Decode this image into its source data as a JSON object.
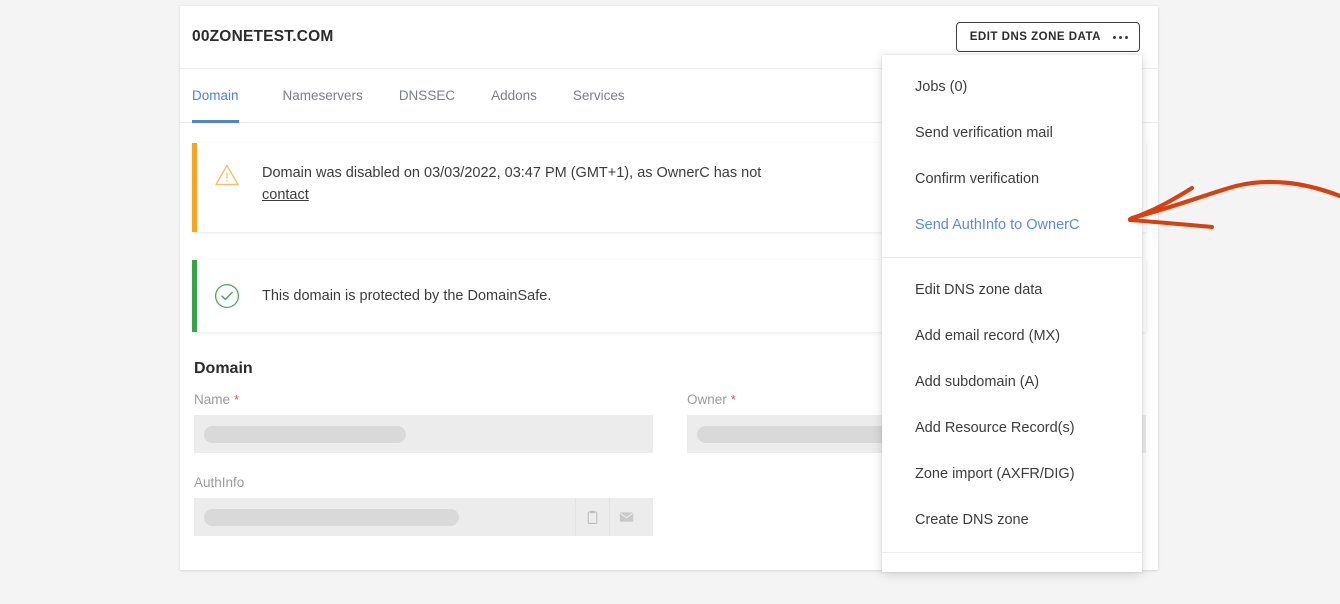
{
  "header": {
    "title": "00ZONETEST.COM",
    "edit_zone_button": "EDIT DNS ZONE DATA",
    "kebab_icon": "more-horizontal-icon"
  },
  "tabs": [
    {
      "label": "Domain",
      "active": true
    },
    {
      "label": "Nameservers",
      "active": false
    },
    {
      "label": "DNSSEC",
      "active": false
    },
    {
      "label": "Addons",
      "active": false
    },
    {
      "label": "Services",
      "active": false
    }
  ],
  "alerts": [
    {
      "type": "warning",
      "icon": "warning-triangle-icon",
      "text": "Domain was disabled on 03/03/2022, 03:47 PM (GMT+1), as OwnerC has not",
      "link": "contact",
      "bar_color": "#f5a623"
    },
    {
      "type": "success",
      "icon": "check-circle-icon",
      "text": "This domain is protected by the DomainSafe.",
      "bar_color": "#37a24a"
    }
  ],
  "form": {
    "section_title": "Domain",
    "fields": [
      {
        "label": "Name",
        "required": true,
        "value": "",
        "skeleton_width": "46%"
      },
      {
        "label": "Owner",
        "required": true,
        "value": "",
        "skeleton_width": "78%"
      },
      {
        "label": "AuthInfo",
        "required": false,
        "value": "",
        "skeleton_width": "58%",
        "actions": [
          "clipboard-icon",
          "mail-icon"
        ]
      }
    ],
    "required_marker": "*"
  },
  "dropdown": {
    "groups": [
      {
        "items": [
          {
            "label": "Jobs (0)",
            "highlight": false
          },
          {
            "label": "Send verification mail",
            "highlight": false
          },
          {
            "label": "Confirm verification",
            "highlight": false
          },
          {
            "label": "Send AuthInfo to OwnerC",
            "highlight": true
          }
        ]
      },
      {
        "items": [
          {
            "label": "Edit DNS zone data",
            "highlight": false
          },
          {
            "label": "Add email record (MX)",
            "highlight": false
          },
          {
            "label": "Add subdomain (A)",
            "highlight": false
          },
          {
            "label": "Add Resource Record(s)",
            "highlight": false
          },
          {
            "label": "Zone import (AXFR/DIG)",
            "highlight": false
          },
          {
            "label": "Create DNS zone",
            "highlight": false
          }
        ]
      }
    ]
  },
  "annotation": {
    "type": "arrow",
    "color": "#d9400f",
    "points_to": "Send AuthInfo to OwnerC"
  },
  "colors": {
    "accent_blue": "#4f83d8",
    "page_background": "#f4f4f4",
    "card_background": "#ffffff",
    "warning": "#f5a623",
    "success": "#37a24a",
    "required": "#e8503a",
    "annotation": "#d9400f"
  }
}
